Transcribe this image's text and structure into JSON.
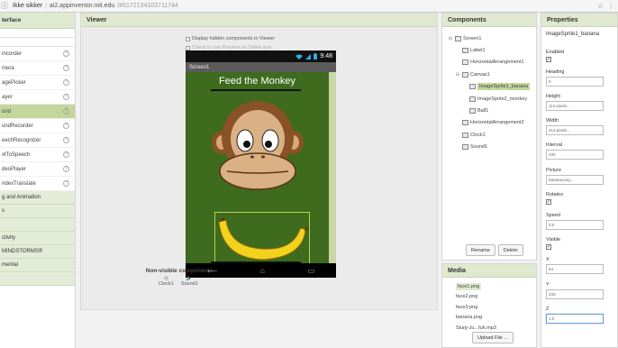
{
  "browser": {
    "security_label": "Ikke sikker",
    "url_host": "ai2.appinventor.mit.edu",
    "url_hash": "/#6172134103711744"
  },
  "palette": {
    "header": "terface",
    "items": [
      {
        "label": "mcorder"
      },
      {
        "label": "mera"
      },
      {
        "label": "agePicker"
      },
      {
        "label": "ayer"
      },
      {
        "label": "und",
        "selected": true
      },
      {
        "label": "undRecorder"
      },
      {
        "label": "eechRecognizer"
      },
      {
        "label": "xtToSpeech"
      },
      {
        "label": "deoPlayer"
      },
      {
        "label": "ndexTranslate"
      }
    ],
    "categories": [
      "g and Animation",
      "s",
      "",
      "ctivity",
      " MINDSTORMS®",
      "mental",
      ""
    ]
  },
  "viewer": {
    "title": "Viewer",
    "check_hidden": "Display hidden components in Viewer",
    "check_tablet": "Check to see Preview on Tablet size.",
    "status_time": "9:48",
    "screen_title": "Screen1",
    "feed_label": "Feed the Monkey",
    "nonvisible_title": "Non-visible components",
    "nonvisible_items": [
      "Clock1",
      "Sound1"
    ]
  },
  "components": {
    "title": "Components",
    "tree": [
      {
        "label": "Screen1",
        "toggle": "⊟",
        "depth": 0
      },
      {
        "label": "Label1",
        "toggle": "",
        "depth": 1
      },
      {
        "label": "HorizontalArrangement1",
        "toggle": "",
        "depth": 1
      },
      {
        "label": "Canvas1",
        "toggle": "⊟",
        "depth": 1
      },
      {
        "label": "ImageSprite1_banana",
        "toggle": "",
        "depth": 2,
        "selected": true
      },
      {
        "label": "ImageSprite2_monkey",
        "toggle": "",
        "depth": 2
      },
      {
        "label": "Ball1",
        "toggle": "",
        "depth": 2
      },
      {
        "label": "HorizontalArrangement2",
        "toggle": "",
        "depth": 1
      },
      {
        "label": "Clock1",
        "toggle": "",
        "depth": 1
      },
      {
        "label": "Sound1",
        "toggle": "",
        "depth": 1
      }
    ],
    "rename_label": "Rename",
    "delete_label": "Delete"
  },
  "media": {
    "title": "Media",
    "files": [
      "face1.png",
      "face2.png",
      "face3.png",
      "banana.png",
      "Slurp-Ju...fuh.mp3"
    ],
    "upload_label": "Upload File ..."
  },
  "properties": {
    "title": "Properties",
    "component": "ImageSprite1_banana",
    "enabled_label": "Enabled",
    "heading_label": "Heading",
    "heading_value": "0",
    "height_label": "Height",
    "height_value": "114 pixels...",
    "width_label": "Width",
    "width_value": "213 pixels...",
    "interval_label": "Interval",
    "interval_value": "100",
    "picture_label": "Picture",
    "picture_value": "banana.png...",
    "rotates_label": "Rotates",
    "speed_label": "Speed",
    "speed_value": "0.0",
    "visible_label": "Visible",
    "x_label": "X",
    "x_value": "64",
    "y_label": "Y",
    "y_value": "233",
    "z_label": "Z",
    "z_value": "1.0"
  }
}
